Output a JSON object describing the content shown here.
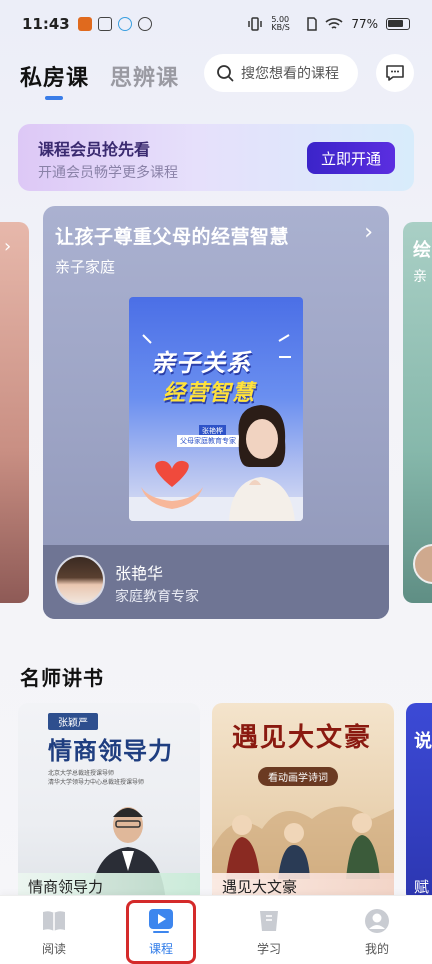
{
  "status_bar": {
    "time": "11:43",
    "network_speed": "5.00 KB/S",
    "battery": "77%"
  },
  "header": {
    "tab_active": "私房课",
    "tab_other": "思辨课",
    "search_placeholder": "搜您想看的课程",
    "message_icon": "message-icon"
  },
  "banner": {
    "title": "课程会员抢先看",
    "subtitle": "开通会员畅学更多课程",
    "button": "立即开通"
  },
  "carousel": {
    "main_card": {
      "title": "让孩子尊重父母的经营智慧",
      "category": "亲子家庭",
      "poster_title_line1": "亲子关系",
      "poster_title_line2": "经营智慧",
      "poster_name_tag": "张艳桦",
      "poster_role_tag": "父母家庭教育专家",
      "teacher_name": "张艳华",
      "teacher_title": "家庭教育专家"
    },
    "right_card": {
      "title_fragment": "绘",
      "sub_fragment": "亲"
    }
  },
  "section": {
    "title": "名师讲书",
    "books": [
      {
        "author_tag": "张颖严",
        "cover_title": "情商领导力",
        "cover_lines": [
          "北京大学总裁班授课导师",
          "清华大学领导力中心总裁班授课导师"
        ],
        "label": "情商领导力"
      },
      {
        "cover_title": "遇见大文豪",
        "cover_sub": "看动画学诗词",
        "label": "遇见大文豪"
      },
      {
        "cover_fragment": "说",
        "label": "赋"
      }
    ]
  },
  "bottom_nav": {
    "items": [
      {
        "label": "阅读",
        "icon": "book-icon",
        "active": false
      },
      {
        "label": "课程",
        "icon": "play-icon",
        "active": true
      },
      {
        "label": "学习",
        "icon": "study-icon",
        "active": false
      },
      {
        "label": "我的",
        "icon": "profile-icon",
        "active": false
      }
    ]
  },
  "colors": {
    "accent_blue": "#2f7be8",
    "banner_button": "#3b24c9",
    "highlight_red": "#d42a2a"
  }
}
